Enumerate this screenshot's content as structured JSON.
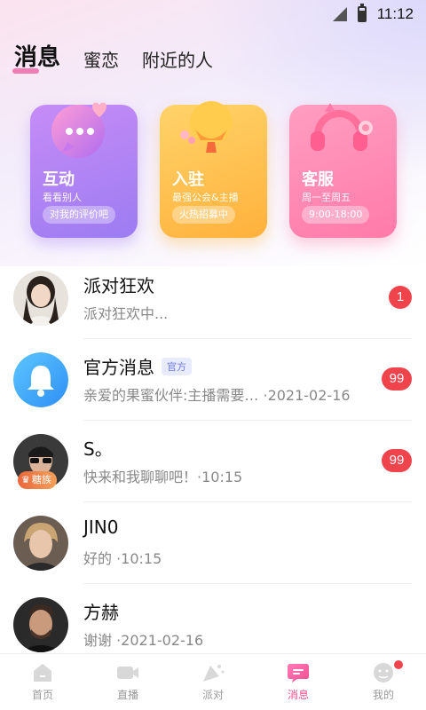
{
  "status_bar": {
    "time": "11:12"
  },
  "tabs": [
    {
      "label": "消息",
      "active": true
    },
    {
      "label": "蜜恋",
      "active": false
    },
    {
      "label": "附近的人",
      "active": false
    }
  ],
  "cards": [
    {
      "title": "互动",
      "subtitle": "看看别人",
      "pill": "对我的评价吧",
      "color": "#a07cf2"
    },
    {
      "title": "入驻",
      "subtitle": "最强公会&主播",
      "pill": "火热招募中",
      "color": "#ffb13b"
    },
    {
      "title": "客服",
      "subtitle": "周一至周五",
      "pill": "9:00-18:00",
      "color": "#ff7aa8"
    }
  ],
  "messages": [
    {
      "name": "派对狂欢",
      "preview": "派对狂欢中...",
      "badge": "1"
    },
    {
      "name": "官方消息",
      "tag": "官方",
      "preview": "亲爱的果蜜伙伴:主播需要…  ·2021-02-16",
      "badge": "99"
    },
    {
      "name": "S。",
      "fan_tag": "糖族",
      "preview": "快来和我聊聊吧！·10:15",
      "badge": "99"
    },
    {
      "name": "JIN0",
      "preview": "好的  ·10:15"
    },
    {
      "name": "方赫",
      "preview": "谢谢  ·2021-02-16"
    }
  ],
  "bottom_nav": [
    {
      "label": "首页",
      "icon": "home-icon"
    },
    {
      "label": "直播",
      "icon": "video-icon"
    },
    {
      "label": "派对",
      "icon": "party-icon"
    },
    {
      "label": "消息",
      "icon": "message-icon",
      "active": true
    },
    {
      "label": "我的",
      "icon": "profile-icon",
      "has_dot": true
    }
  ],
  "colors": {
    "accent": "#f0508f",
    "badge": "#f0444d"
  }
}
